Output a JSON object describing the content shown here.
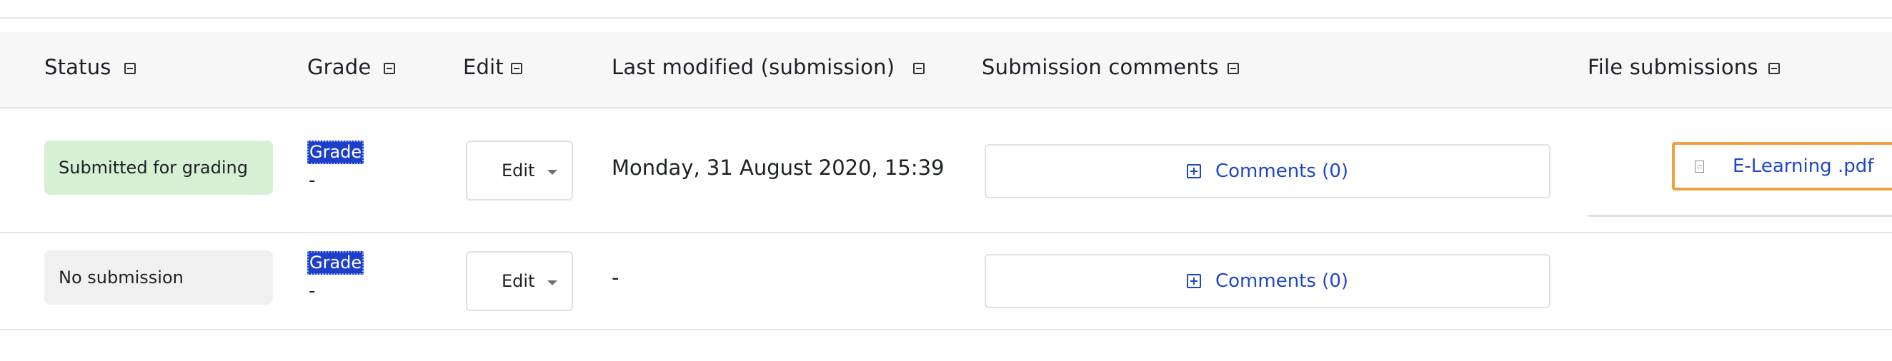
{
  "columns": {
    "status": "Status",
    "grade": "Grade",
    "edit": "Edit",
    "last_modified": "Last modified (submission)",
    "submission_comments": "Submission comments",
    "file_submissions": "File submissions"
  },
  "rows": [
    {
      "status": "Submitted for grading",
      "grade_label": "Grade",
      "grade_value": "-",
      "edit_label": "Edit",
      "last_modified": "Monday, 31 August 2020, 15:39",
      "comments": "Comments (0)",
      "file": "E-Learning .pdf"
    },
    {
      "status": "No submission",
      "grade_label": "Grade",
      "grade_value": "-",
      "edit_label": "Edit",
      "last_modified": "-",
      "comments": "Comments (0)",
      "file": ""
    }
  ],
  "colors": {
    "submitted_status": "#d7efd4",
    "no_submission_status": "#f0f0f0",
    "link": "#1f47c4",
    "grade_highlight": "#1e40c8",
    "file_focus_outline": "#f0a040"
  },
  "icons": {
    "collapse": "minus-square-icon",
    "expand": "plus-square-icon",
    "file": "document-icon",
    "dropdown": "caret-down-icon"
  }
}
